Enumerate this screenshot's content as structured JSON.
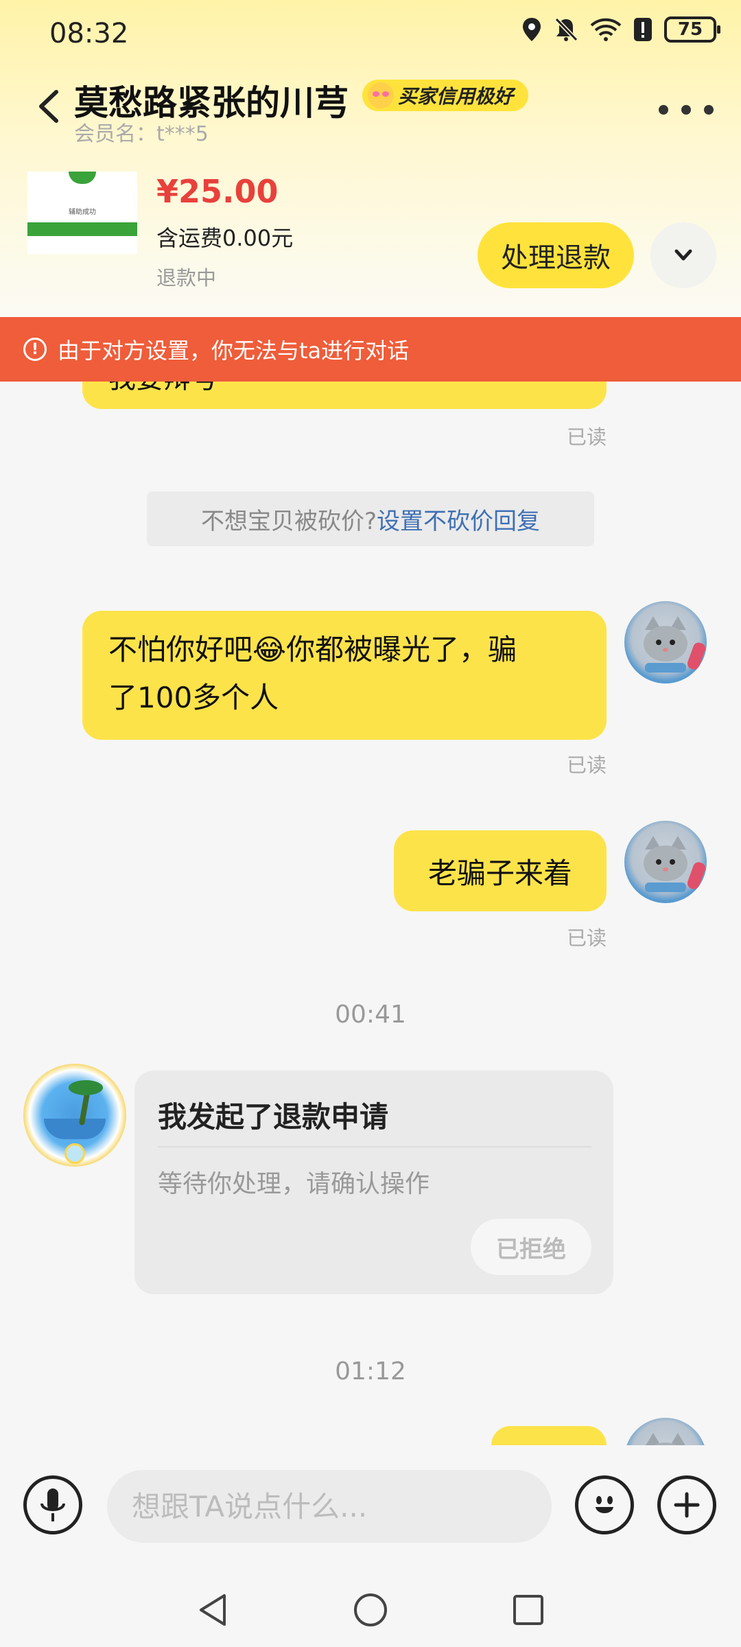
{
  "status_bar": {
    "time": "08:32",
    "battery": "75"
  },
  "header": {
    "title": "莫愁路紧张的川芎",
    "credit_badge": "买家信用极好",
    "member": "会员名：t***5"
  },
  "product": {
    "thumb_text": "辅助成功",
    "price": "¥25.00",
    "shipping": "含运费0.00元",
    "status": "退款中",
    "action_button": "处理退款"
  },
  "warning": {
    "text": "由于对方设置，你无法与ta进行对话"
  },
  "messages": {
    "m0_partial": "我要辩号",
    "read_label": "已读",
    "sys_tip_question": "不想宝贝被砍价?",
    "sys_tip_link": "设置不砍价回复",
    "m1_line1": "不怕你好吧😂你都被曝光了，骗",
    "m1_line2": "了100多个人",
    "m2": "老骗子来着",
    "time1": "00:41",
    "time2": "01:12"
  },
  "refund_card": {
    "title": "我发起了退款申请",
    "desc": "等待你处理，请确认操作",
    "button": "已拒绝"
  },
  "input": {
    "placeholder": "想跟TA说点什么..."
  },
  "colors": {
    "accent_yellow": "#fde34a",
    "warning_red": "#ef5d3a",
    "price_red": "#e8413c",
    "link_blue": "#3e6fb4"
  },
  "icons": {
    "back": "chevron-left-icon",
    "more": "more-horizontal-icon",
    "expand": "chevron-down-icon",
    "warning": "exclamation-circle-icon",
    "voice": "microphone-icon",
    "emoji": "smiley-icon",
    "plus": "plus-icon",
    "nav_back": "triangle-back-icon",
    "nav_home": "circle-home-icon",
    "nav_recent": "square-recent-icon"
  }
}
